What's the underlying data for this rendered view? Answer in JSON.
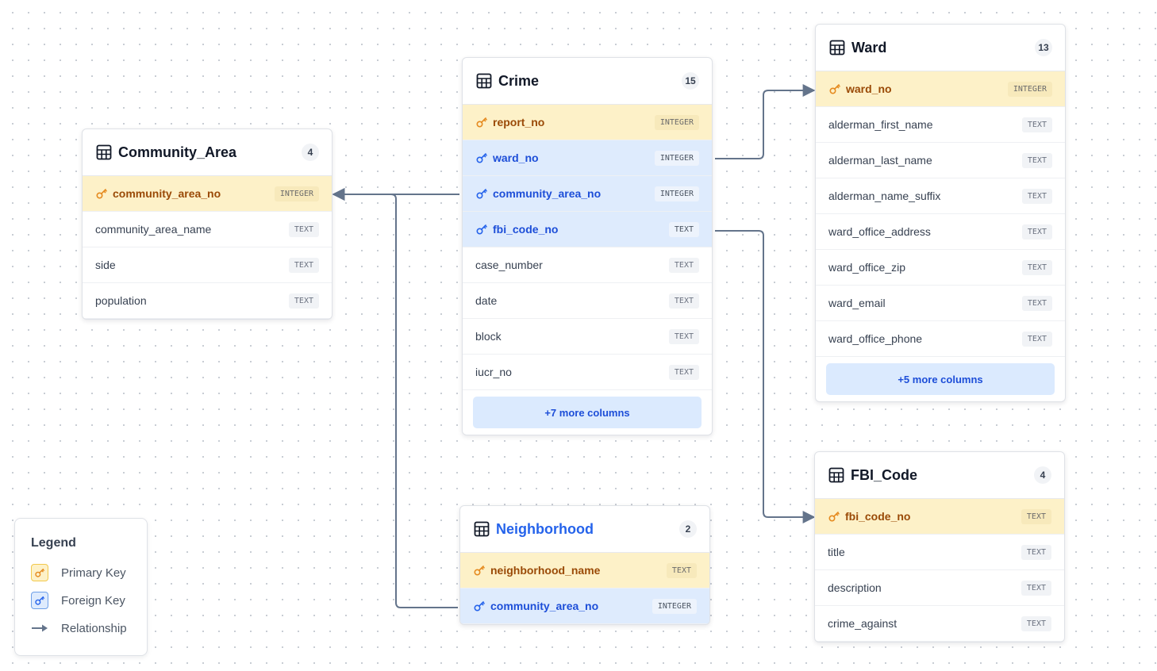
{
  "colors": {
    "edge": "#64748b",
    "pk_icon": "#e58a1f",
    "fk_icon": "#2563eb"
  },
  "tables": {
    "community_area": {
      "name": "Community_Area",
      "count": "4",
      "columns": [
        {
          "name": "community_area_no",
          "type": "INTEGER",
          "key": "pk"
        },
        {
          "name": "community_area_name",
          "type": "TEXT",
          "key": ""
        },
        {
          "name": "side",
          "type": "TEXT",
          "key": ""
        },
        {
          "name": "population",
          "type": "TEXT",
          "key": ""
        }
      ]
    },
    "crime": {
      "name": "Crime",
      "count": "15",
      "columns": [
        {
          "name": "report_no",
          "type": "INTEGER",
          "key": "pk"
        },
        {
          "name": "ward_no",
          "type": "INTEGER",
          "key": "fk"
        },
        {
          "name": "community_area_no",
          "type": "INTEGER",
          "key": "fk"
        },
        {
          "name": "fbi_code_no",
          "type": "TEXT",
          "key": "fk"
        },
        {
          "name": "case_number",
          "type": "TEXT",
          "key": ""
        },
        {
          "name": "date",
          "type": "TEXT",
          "key": ""
        },
        {
          "name": "block",
          "type": "TEXT",
          "key": ""
        },
        {
          "name": "iucr_no",
          "type": "TEXT",
          "key": ""
        }
      ],
      "more": "+7 more columns"
    },
    "ward": {
      "name": "Ward",
      "count": "13",
      "columns": [
        {
          "name": "ward_no",
          "type": "INTEGER",
          "key": "pk"
        },
        {
          "name": "alderman_first_name",
          "type": "TEXT",
          "key": ""
        },
        {
          "name": "alderman_last_name",
          "type": "TEXT",
          "key": ""
        },
        {
          "name": "alderman_name_suffix",
          "type": "TEXT",
          "key": ""
        },
        {
          "name": "ward_office_address",
          "type": "TEXT",
          "key": ""
        },
        {
          "name": "ward_office_zip",
          "type": "TEXT",
          "key": ""
        },
        {
          "name": "ward_email",
          "type": "TEXT",
          "key": ""
        },
        {
          "name": "ward_office_phone",
          "type": "TEXT",
          "key": ""
        }
      ],
      "more": "+5 more columns"
    },
    "fbi_code": {
      "name": "FBI_Code",
      "count": "4",
      "columns": [
        {
          "name": "fbi_code_no",
          "type": "TEXT",
          "key": "pk"
        },
        {
          "name": "title",
          "type": "TEXT",
          "key": ""
        },
        {
          "name": "description",
          "type": "TEXT",
          "key": ""
        },
        {
          "name": "crime_against",
          "type": "TEXT",
          "key": ""
        }
      ]
    },
    "neighborhood": {
      "name": "Neighborhood",
      "count": "2",
      "columns": [
        {
          "name": "neighborhood_name",
          "type": "TEXT",
          "key": "pk"
        },
        {
          "name": "community_area_no",
          "type": "INTEGER",
          "key": "fk"
        }
      ]
    }
  },
  "legend": {
    "title": "Legend",
    "primary_key": "Primary Key",
    "foreign_key": "Foreign Key",
    "relationship": "Relationship"
  }
}
